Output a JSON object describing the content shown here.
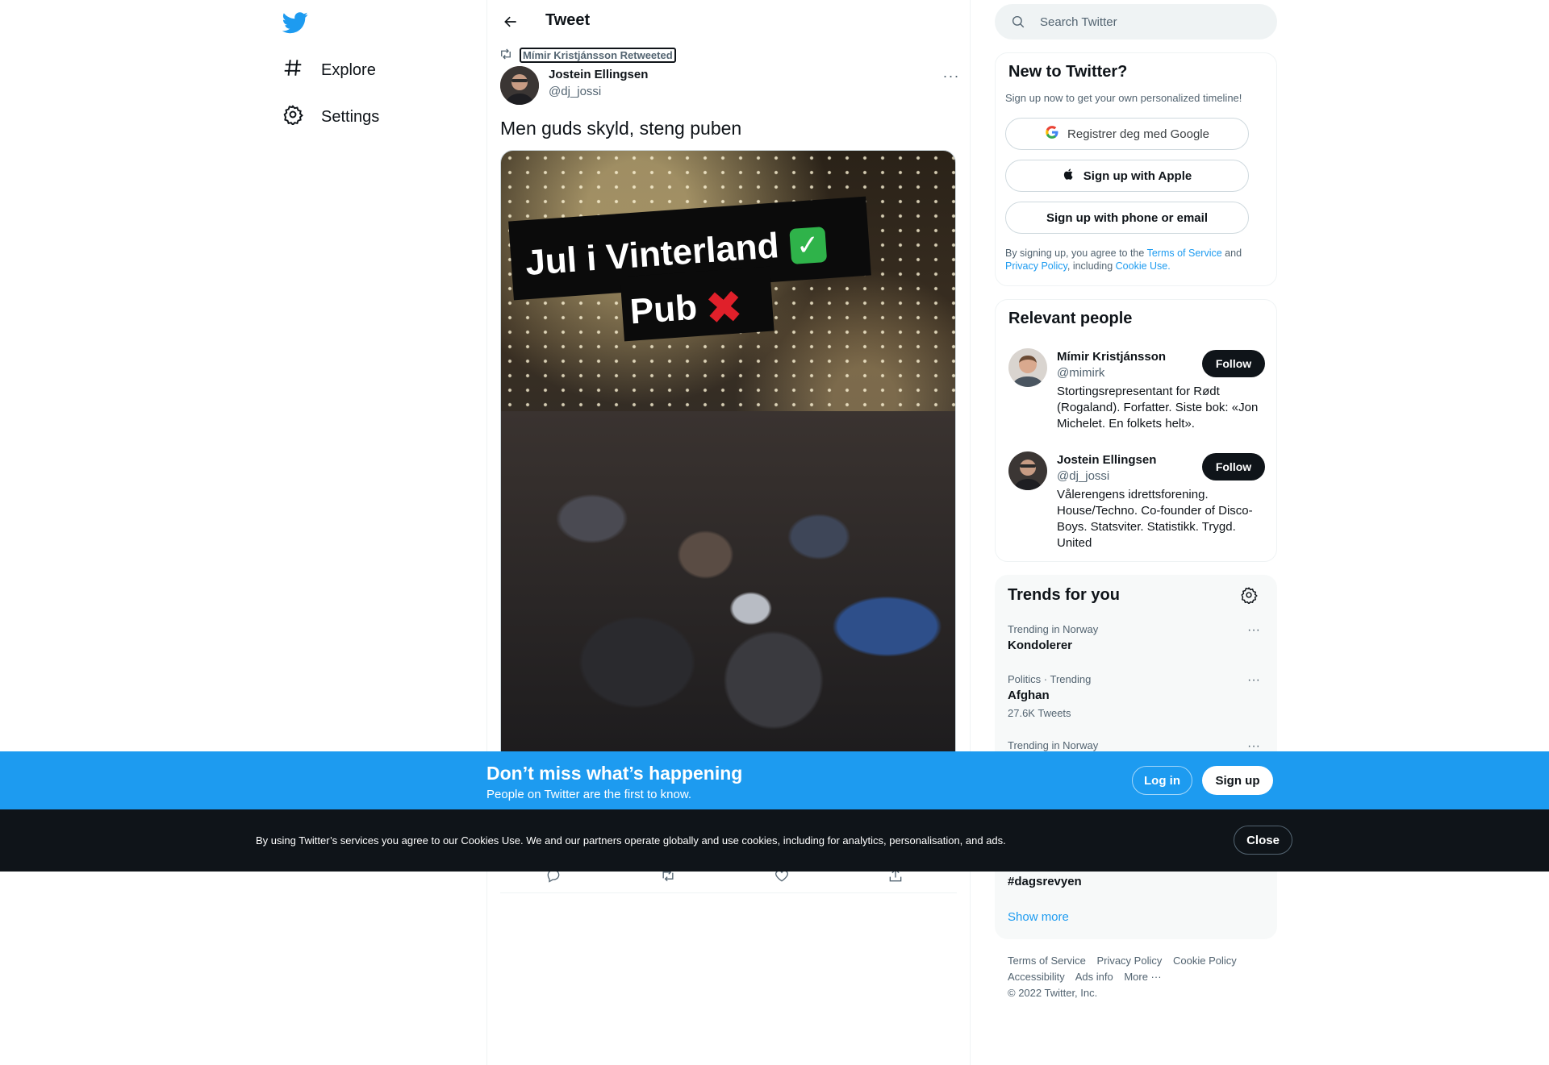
{
  "nav": {
    "logo": "twitter-bird-icon",
    "items": [
      {
        "label": "Explore",
        "icon": "hashtag-icon"
      },
      {
        "label": "Settings",
        "icon": "gear-icon"
      }
    ]
  },
  "main": {
    "header_title": "Tweet",
    "retweeted_by": "Mímir Kristjánsson Retweeted",
    "tweet": {
      "author_name": "Jostein Ellingsen",
      "author_handle": "@dj_jossi",
      "text": "Men guds skyld, steng puben",
      "image_caption_line1": "Jul i Vinterland",
      "image_caption_line2": "Pub"
    }
  },
  "search": {
    "placeholder": "Search Twitter"
  },
  "new_to_twitter": {
    "title": "New to Twitter?",
    "subtitle": "Sign up now to get your own personalized timeline!",
    "google_label": "Registrer deg med Google",
    "apple_label": "Sign up with Apple",
    "phone_label": "Sign up with phone or email",
    "legal_pre": "By signing up, you agree to the ",
    "terms": "Terms of Service",
    "and": " and ",
    "privacy": "Privacy Policy",
    "including": ", including ",
    "cookie_use": "Cookie Use."
  },
  "relevant_people": {
    "title": "Relevant people",
    "people": [
      {
        "name": "Mímir Kristjánsson",
        "handle": "@mimirk",
        "bio": "Stortingsrepresentant for Rødt (Rogaland). Forfatter. Siste bok: «Jon Michelet. En folkets helt».",
        "follow": "Follow"
      },
      {
        "name": "Jostein Ellingsen",
        "handle": "@dj_jossi",
        "bio": "Vålerengens idrettsforening. House/Techno. Co-founder of Disco-Boys. Statsviter. Statistikk. Trygd. United",
        "follow": "Follow"
      }
    ]
  },
  "trends": {
    "title": "Trends for you",
    "items": [
      {
        "meta": "Trending in Norway",
        "name": "Kondolerer",
        "count": ""
      },
      {
        "meta": "Politics · Trending",
        "name": "Afghan",
        "count": "27.6K Tweets"
      },
      {
        "meta": "Trending in Norway",
        "name": "",
        "count": ""
      },
      {
        "meta": "",
        "name": "#dagsrevyen",
        "count": ""
      }
    ],
    "show_more": "Show more"
  },
  "footer": {
    "links": [
      "Terms of Service",
      "Privacy Policy",
      "Cookie Policy",
      "Accessibility",
      "Ads info",
      "More ···"
    ],
    "copyright": "© 2022 Twitter, Inc."
  },
  "dont_miss": {
    "title": "Don’t miss what’s happening",
    "subtitle": "People on Twitter are the first to know.",
    "login": "Log in",
    "signup": "Sign up"
  },
  "cookie_bar": {
    "text": "By using Twitter’s services you agree to our Cookies Use. We and our partners operate globally and use cookies, including for analytics, personalisation, and ads.",
    "close": "Close"
  },
  "colors": {
    "accent": "#1d9bf0",
    "dark": "#0f1419",
    "muted": "#536471"
  }
}
